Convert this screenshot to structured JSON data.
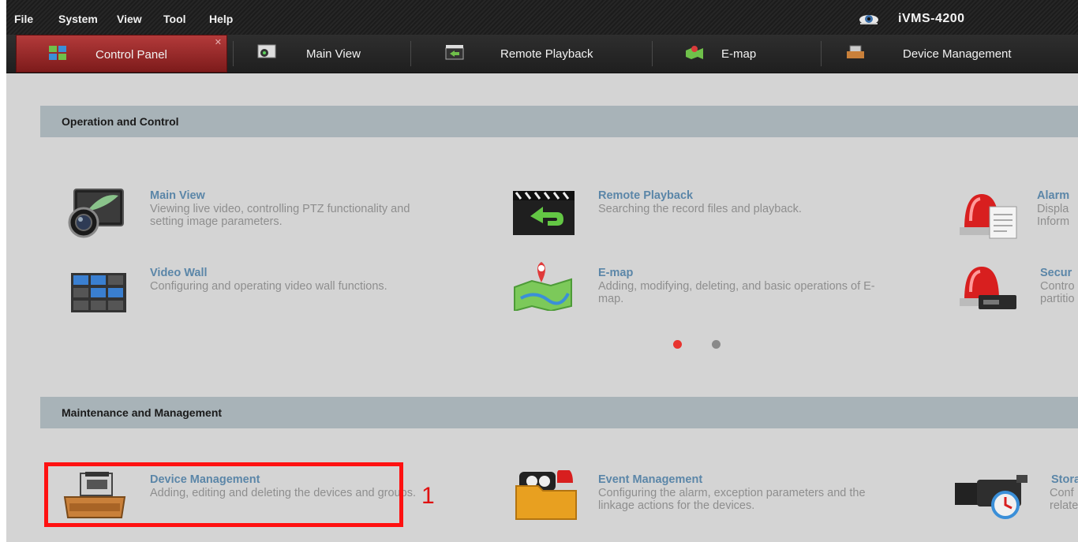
{
  "menu": [
    "File",
    "System",
    "View",
    "Tool",
    "Help"
  ],
  "app_title": "iVMS-4200",
  "tabs": [
    {
      "label": "Control Panel",
      "icon": "control-panel-icon",
      "active": true
    },
    {
      "label": "Main View",
      "icon": "main-view-icon"
    },
    {
      "label": "Remote Playback",
      "icon": "remote-playback-icon"
    },
    {
      "label": "E-map",
      "icon": "emap-icon"
    },
    {
      "label": "Device Management",
      "icon": "device-management-icon"
    }
  ],
  "sections": {
    "operation": {
      "title": "Operation and Control",
      "modules": [
        {
          "title": "Main View",
          "desc": "Viewing live video, controlling PTZ functionality and setting image parameters.",
          "icon": "camera-lens-icon"
        },
        {
          "title": "Remote Playback",
          "desc": "Searching the record files and playback.",
          "icon": "clapperboard-playback-icon"
        },
        {
          "title": "Alarm",
          "desc": "Displa Inform",
          "icon": "alarm-siren-icon"
        },
        {
          "title": "Video Wall",
          "desc": "Configuring and operating video wall functions.",
          "icon": "video-wall-grid-icon"
        },
        {
          "title": "E-map",
          "desc": "Adding, modifying, deleting, and basic operations of E-map.",
          "icon": "map-pin-icon"
        },
        {
          "title": "Secur",
          "desc": "Contro partitio",
          "icon": "security-siren-icon"
        }
      ]
    },
    "maintenance": {
      "title": "Maintenance and Management",
      "modules": [
        {
          "title": "Device Management",
          "desc": "Adding, editing and deleting the devices and groups.",
          "icon": "device-tray-icon"
        },
        {
          "title": "Event Management",
          "desc": "Configuring the alarm, exception parameters and the linkage actions for the devices.",
          "icon": "event-folder-icon"
        },
        {
          "title": "Stora",
          "desc": "Conf relate",
          "icon": "storage-camera-icon"
        }
      ]
    }
  },
  "pager": {
    "active": 1,
    "total": 2
  },
  "annotation": "1",
  "colors": {
    "accent_red": "#9b2626",
    "link_blue": "#5b86a8",
    "header_gray": "#a8b3b8",
    "highlight": "#ff1111"
  }
}
